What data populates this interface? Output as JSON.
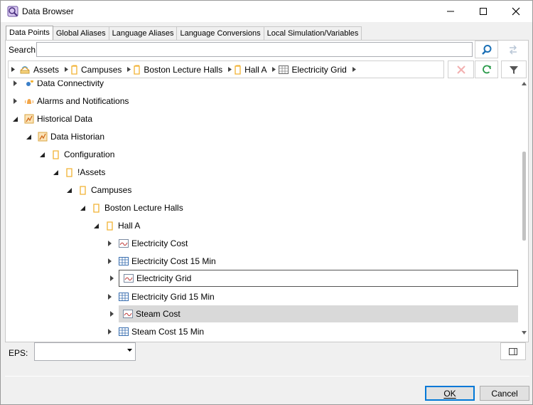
{
  "window": {
    "title": "Data Browser",
    "minimize_icon": "minimize-icon",
    "maximize_icon": "maximize-icon",
    "close_icon": "close-icon"
  },
  "tabs": [
    {
      "label": "Data Points",
      "active": true
    },
    {
      "label": "Global Aliases",
      "active": false
    },
    {
      "label": "Language Aliases",
      "active": false
    },
    {
      "label": "Language Conversions",
      "active": false
    },
    {
      "label": "Local Simulation/Variables",
      "active": false
    }
  ],
  "search": {
    "label": "Search:",
    "value": "",
    "search_icon": "magnifier-icon",
    "swap_icon": "swap-arrows-icon"
  },
  "breadcrumb": [
    {
      "label": "Assets",
      "icon": "assets-icon"
    },
    {
      "label": "Campuses",
      "icon": "folder-icon"
    },
    {
      "label": "Boston Lecture Halls",
      "icon": "folder-icon"
    },
    {
      "label": "Hall A",
      "icon": "folder-icon"
    },
    {
      "label": "Electricity Grid",
      "icon": "grid-icon"
    }
  ],
  "toolbar": {
    "clear_icon": "x-icon",
    "refresh_icon": "refresh-icon",
    "filter_icon": "filter-icon"
  },
  "tree": [
    {
      "label": "Data Connectivity",
      "icon": "gear-icon",
      "expanded": false
    },
    {
      "label": "Alarms and Notifications",
      "icon": "alarm-icon",
      "expanded": false
    },
    {
      "label": "Historical Data",
      "icon": "historian-icon",
      "expanded": true
    },
    {
      "label": "Data Historian",
      "icon": "historian-icon",
      "expanded": true
    },
    {
      "label": "Configuration",
      "icon": "folder-icon",
      "expanded": true
    },
    {
      "label": "!Assets",
      "icon": "folder-icon",
      "expanded": true
    },
    {
      "label": "Campuses",
      "icon": "folder-icon",
      "expanded": true
    },
    {
      "label": "Boston Lecture Halls",
      "icon": "folder-icon",
      "expanded": true
    },
    {
      "label": "Hall A",
      "icon": "folder-icon",
      "expanded": true
    },
    {
      "label": "Electricity Cost",
      "icon": "trend-icon",
      "expanded": false
    },
    {
      "label": "Electricity Cost 15 Min",
      "icon": "grid-icon",
      "expanded": false
    },
    {
      "label": "Electricity Grid",
      "icon": "trend-icon",
      "expanded": false,
      "state": "focused"
    },
    {
      "label": "Electricity Grid 15 Min",
      "icon": "grid-icon",
      "expanded": false
    },
    {
      "label": "Steam Cost",
      "icon": "trend-icon",
      "expanded": false,
      "state": "selected"
    },
    {
      "label": "Steam Cost 15 Min",
      "icon": "grid-icon",
      "expanded": false
    }
  ],
  "eps": {
    "label": "EPS:",
    "value": ""
  },
  "buttons": {
    "ok_label": "OK",
    "cancel_label": "Cancel"
  },
  "colors": {
    "accent": "#0078d7",
    "folder": "#f2b233",
    "selected_row": "#d9d9d9"
  }
}
